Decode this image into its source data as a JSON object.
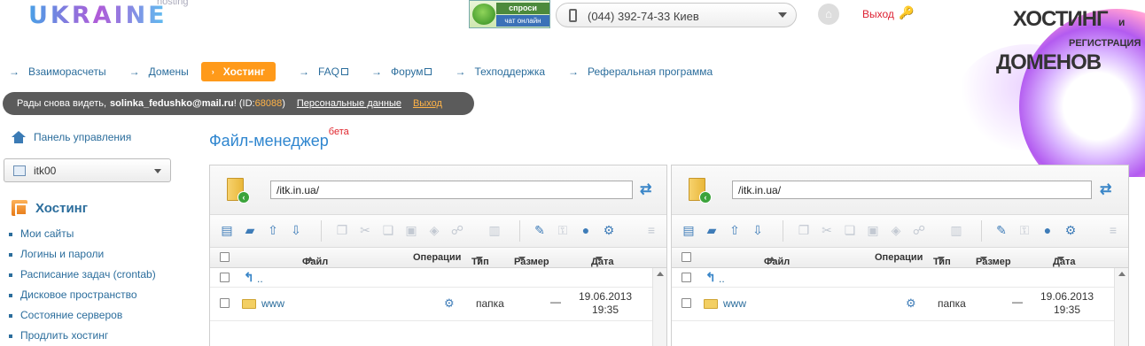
{
  "header": {
    "logo_small": "hosting",
    "logo_big": "UKRAINE",
    "chat_line1": "спроси сейчас!",
    "chat_line2": "чат онлайн",
    "phone": "(044) 392-74-33 Киев",
    "logout": "Выход"
  },
  "promo": {
    "line1": "ХОСТИНГ",
    "line1_suffix": "и",
    "line2": "РЕГИСТРАЦИЯ",
    "line3": "ДОМЕНОВ"
  },
  "nav": {
    "items": [
      {
        "label": "Взаиморасчеты"
      },
      {
        "label": "Домены"
      },
      {
        "label": "Хостинг"
      },
      {
        "label": "FAQ"
      },
      {
        "label": "Форум"
      },
      {
        "label": "Техподдержка"
      },
      {
        "label": "Реферальная программа"
      }
    ]
  },
  "userbar": {
    "greeting": "Рады снова видеть,",
    "email": "solinka_fedushko@mail.ru",
    "id_prefix": "! (ID:",
    "id": "68088",
    "id_suffix": ")",
    "personal": "Персональные данные",
    "logout": "Выход"
  },
  "sidebar": {
    "panel_link": "Панель управления",
    "account": "itk00",
    "section": "Хостинг",
    "items": [
      {
        "label": "Мои сайты"
      },
      {
        "label": "Логины и пароли"
      },
      {
        "label": "Расписание задач (crontab)"
      },
      {
        "label": "Дисковое пространство"
      },
      {
        "label": "Состояние серверов"
      },
      {
        "label": "Продлить хостинг"
      }
    ]
  },
  "main": {
    "title": "Файл-менеджер",
    "title_sup": "бета"
  },
  "panes": {
    "left": {
      "path": "/itk.in.ua/",
      "columns": {
        "file": "Файл",
        "ops": "Операции",
        "type": "Тип",
        "size": "Размер",
        "date": "Дата"
      },
      "up": "..",
      "rows": [
        {
          "name": "www",
          "type": "папка",
          "size": "—",
          "date": "19.06.2013 19:35"
        }
      ]
    },
    "right": {
      "path": "/itk.in.ua/",
      "columns": {
        "file": "Файл",
        "ops": "Операции",
        "type": "Тип",
        "size": "Размер",
        "date": "Дата"
      },
      "up": "..",
      "rows": [
        {
          "name": "www",
          "type": "папка",
          "size": "—",
          "date": "19.06.2013 19:35"
        }
      ]
    }
  }
}
